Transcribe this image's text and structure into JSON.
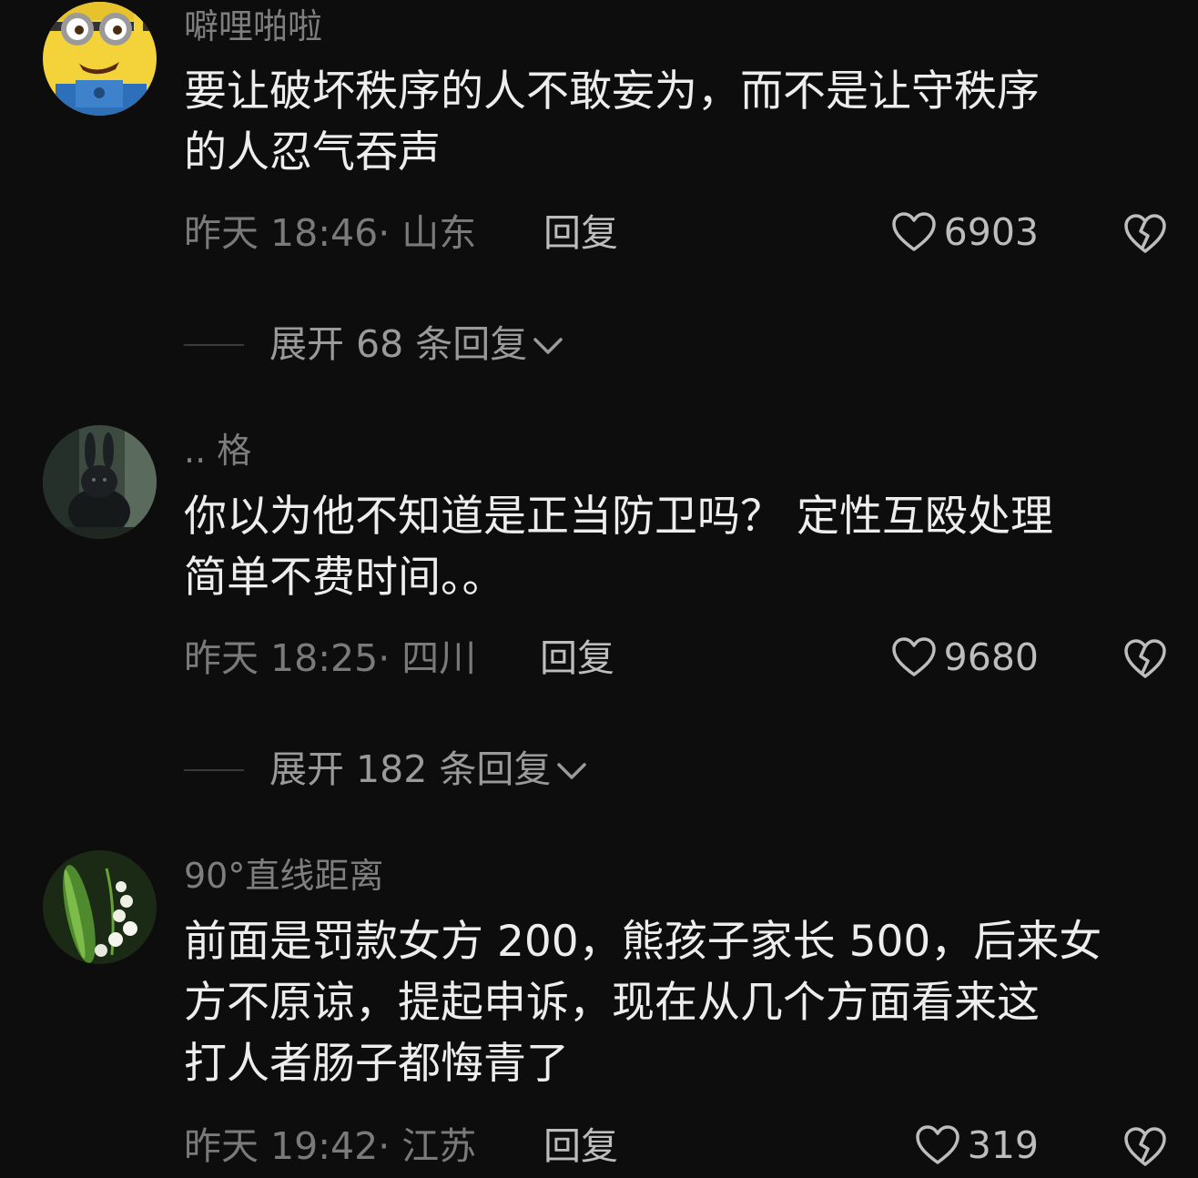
{
  "comments": [
    {
      "username": "噼哩啪啦",
      "content_lines": [
        "要让破坏秩序的人不敢妄为，而不是让守秩序",
        "的人忍气吞声"
      ],
      "meta": "昨天 18:46· 山东",
      "reply_label": "回复",
      "likes": "6903",
      "expand_label": "展开 68 条回复"
    },
    {
      "username": ".. 格",
      "content_lines": [
        "你以为他不知道是正当防卫吗？  定性互殴处理",
        "简单不费时间。。"
      ],
      "meta": "昨天 18:25· 四川",
      "reply_label": "回复",
      "likes": "9680",
      "expand_label": "展开 182 条回复"
    },
    {
      "username": "90°直线距离",
      "content_lines": [
        "前面是罚款女方 200，熊孩子家长 500，后来女",
        "方不原谅，提起申诉，现在从几个方面看来这",
        "打人者肠子都悔青了"
      ],
      "meta": "昨天 19:42· 江苏",
      "reply_label": "回复",
      "likes": "319"
    }
  ],
  "icons": {
    "like": "heart-outline-icon",
    "dislike": "broken-heart-icon",
    "expand": "chevron-down-icon"
  },
  "colors": {
    "background": "#0d0d0d",
    "text_primary": "#ededed",
    "text_secondary": "#7a7a7a",
    "icon": "#bdbdbd"
  }
}
